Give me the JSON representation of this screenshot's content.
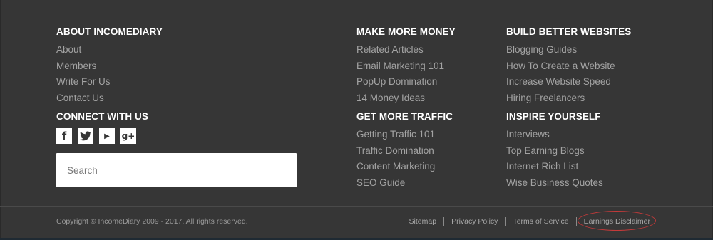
{
  "about": {
    "heading": "ABOUT INCOMEDIARY",
    "links": [
      "About",
      "Members",
      "Write For Us",
      "Contact Us"
    ]
  },
  "connect": {
    "heading": "CONNECT WITH US",
    "icons": [
      {
        "name": "facebook-icon",
        "glyph": "f"
      },
      {
        "name": "twitter-icon",
        "glyph": "🐦"
      },
      {
        "name": "youtube-icon",
        "glyph": "▶"
      },
      {
        "name": "google-plus-icon",
        "glyph": "g+"
      }
    ]
  },
  "search": {
    "placeholder": "Search"
  },
  "money": {
    "heading": "MAKE MORE MONEY",
    "links": [
      "Related Articles",
      "Email Marketing 101",
      "PopUp Domination",
      "14 Money Ideas"
    ]
  },
  "traffic": {
    "heading": "GET MORE TRAFFIC",
    "links": [
      "Getting Traffic 101",
      "Traffic Domination",
      "Content Marketing",
      "SEO Guide"
    ]
  },
  "websites": {
    "heading": "BUILD BETTER WEBSITES",
    "links": [
      "Blogging Guides",
      "How To Create a Website",
      "Increase Website Speed",
      "Hiring Freelancers"
    ]
  },
  "inspire": {
    "heading": "INSPIRE YOURSELF",
    "links": [
      "Interviews",
      "Top Earning Blogs",
      "Internet Rich List",
      "Wise Business Quotes"
    ]
  },
  "bottom": {
    "copyright": "Copyright © IncomeDiary 2009 - 2017. All rights reserved.",
    "links": [
      "Sitemap",
      "Privacy Policy",
      "Terms of Service",
      "Earnings Disclaimer"
    ]
  }
}
